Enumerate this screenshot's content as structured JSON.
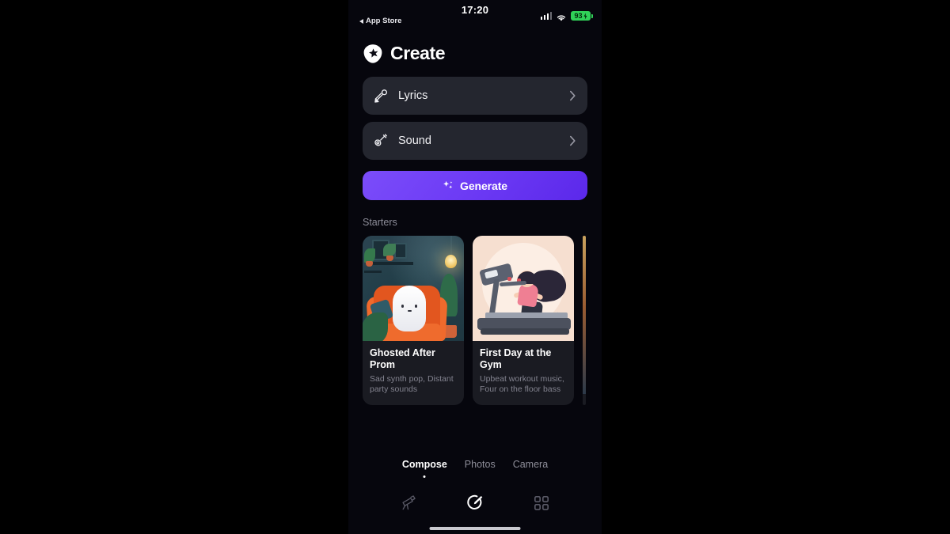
{
  "status_bar": {
    "time": "17:20",
    "back_label": "App Store",
    "back_icon": "triangle-left-icon",
    "signal_icon": "cellular-bars-icon",
    "wifi_icon": "wifi-icon",
    "battery_level": "93",
    "battery_icon": "battery-charging-icon"
  },
  "header": {
    "title": "Create",
    "logo_icon": "app-logo-pick-star-icon"
  },
  "options": [
    {
      "label": "Lyrics",
      "icon": "microphone-icon",
      "chevron": "chevron-right-icon"
    },
    {
      "label": "Sound",
      "icon": "guitar-icon",
      "chevron": "chevron-right-icon"
    }
  ],
  "generate": {
    "label": "Generate",
    "icon": "sparkles-icon",
    "color": "#6d3bf5"
  },
  "starters": {
    "section_title": "Starters",
    "cards": [
      {
        "title": "Ghosted After Prom",
        "subtitle": "Sad synth pop, Distant party sounds",
        "art": "ghost-in-armchair-illustration"
      },
      {
        "title": "First Day at the Gym",
        "subtitle": "Upbeat workout music, Four on the floor bass",
        "art": "girl-on-treadmill-illustration"
      },
      {
        "title": "",
        "subtitle": "",
        "art": "partially-visible-card"
      }
    ]
  },
  "modes": [
    {
      "label": "Compose",
      "active": true
    },
    {
      "label": "Photos",
      "active": false
    },
    {
      "label": "Camera",
      "active": false
    }
  ],
  "tabbar": [
    {
      "icon": "telescope-icon",
      "active": false
    },
    {
      "icon": "compose-circle-pen-icon",
      "active": true
    },
    {
      "icon": "grid-library-icon",
      "active": false
    }
  ],
  "colors": {
    "background": "#06060d",
    "card": "#24262f",
    "accent": "#6d3bf5",
    "battery": "#30d158",
    "muted_text": "#8d8d99"
  }
}
